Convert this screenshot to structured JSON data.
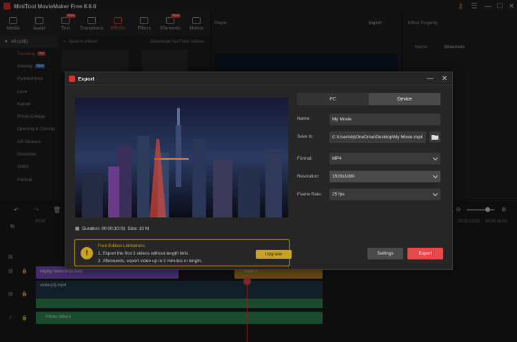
{
  "app": {
    "title": "MiniTool MovieMaker Free 8.8.0"
  },
  "toolbar": {
    "items": [
      {
        "label": "Media",
        "icon": "media-icon"
      },
      {
        "label": "Audio",
        "icon": "music-note-icon"
      },
      {
        "label": "Text",
        "icon": "text-icon",
        "badge": "New"
      },
      {
        "label": "Transitions",
        "icon": "transition-icon"
      },
      {
        "label": "Effects",
        "icon": "effects-icon",
        "active": true
      },
      {
        "label": "Filters",
        "icon": "filter-icon"
      },
      {
        "label": "Elements",
        "icon": "elements-icon",
        "badge": "New"
      },
      {
        "label": "Motion",
        "icon": "motion-icon"
      }
    ]
  },
  "left_panel": {
    "all_label": "All (138)",
    "categories": [
      {
        "label": "Trending",
        "tag": "Hot"
      },
      {
        "label": "Overlay",
        "tag": "New"
      },
      {
        "label": "Pyrotechnics"
      },
      {
        "label": "Love"
      },
      {
        "label": "Nature"
      },
      {
        "label": "Photo Collage"
      },
      {
        "label": "Opening & Closing"
      },
      {
        "label": "AR Stickers"
      },
      {
        "label": "Distortion"
      },
      {
        "label": "Glitch"
      },
      {
        "label": "Particle"
      }
    ]
  },
  "effects_panel": {
    "search_placeholder": "Search effects",
    "download_label": "Download YouTube Videos"
  },
  "player": {
    "title": "Player",
    "export_label": "Export"
  },
  "effect_property": {
    "title": "Effect Property",
    "name_label": "Name:",
    "name_value": "Streamers"
  },
  "timeline": {
    "ruler_start": "00:00",
    "ruler_marks": [
      "00:00:13:00",
      "00:00:16:00"
    ],
    "clips": {
      "text_clip": "Highly recommended",
      "effect_clip": "Pixel 9",
      "video_clip": "video(3).mp4",
      "audio_clip": "Photo Album"
    }
  },
  "export_dialog": {
    "title": "Export",
    "tabs": [
      "PC",
      "Device"
    ],
    "active_tab": "PC",
    "fields": {
      "name_label": "Name:",
      "name_value": "My Movie",
      "save_label": "Save to:",
      "save_value": "C:\\Users\\bj\\OneDrive\\Desktop\\My Movie.mp4",
      "format_label": "Format:",
      "format_value": "MP4",
      "resolution_label": "Resolution:",
      "resolution_value": "1920x1080",
      "framerate_label": "Frame Rate:",
      "framerate_value": "25 fps"
    },
    "duration_label": "Duration:",
    "duration_value": "00:00:10:01",
    "size_label": "Size:",
    "size_value": "10 M",
    "notice": {
      "title": "Free Edition Limitations:",
      "line1": "1. Export the first 3 videos without length limit.",
      "line2": "2. Afterwards, export video up to 2 minutes in length.",
      "upgrade_label": "Upgrade"
    },
    "settings_label": "Settings",
    "export_label": "Export"
  },
  "colors": {
    "accent": "#e34a4a",
    "notice": "#c9a227",
    "text_clip": "#7d4fc4",
    "effect_clip": "#b8822a",
    "audio_wave": "#2e8a52"
  }
}
